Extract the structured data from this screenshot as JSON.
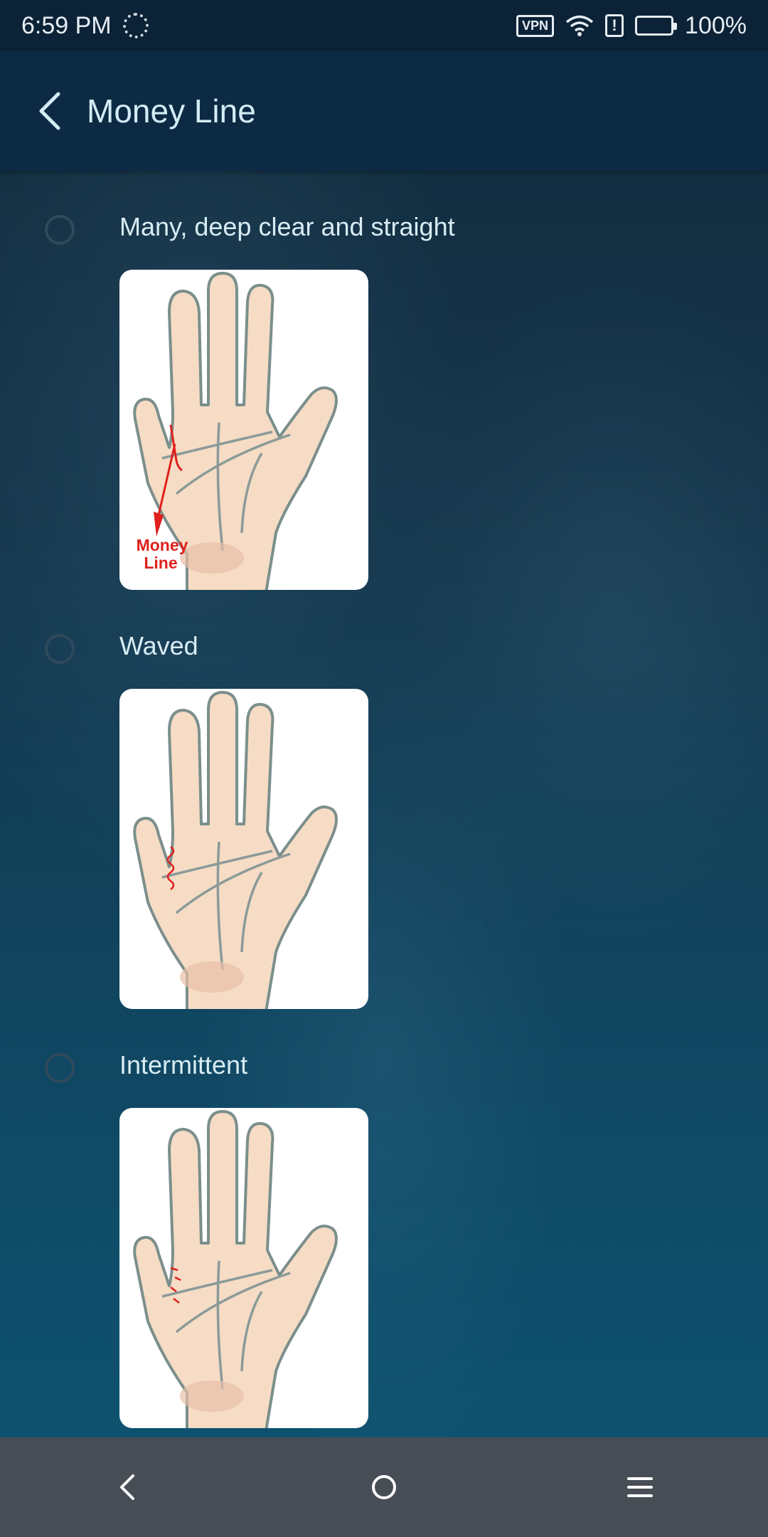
{
  "status_bar": {
    "time": "6:59 PM",
    "vpn_label": "VPN",
    "battery": "100%",
    "icons": [
      "spinner-icon",
      "vpn-icon",
      "wifi-icon",
      "alert-icon",
      "battery-icon"
    ]
  },
  "app_bar": {
    "title": "Money Line",
    "back_icon": "chevron-left-icon"
  },
  "options": [
    {
      "label": "Many, deep clear and straight",
      "image_caption": "Money Line"
    },
    {
      "label": "Waved"
    },
    {
      "label": "Intermittent"
    }
  ],
  "nav_bar": {
    "icons": [
      "nav-back-icon",
      "home-icon",
      "menu-icon"
    ]
  },
  "colors": {
    "app_bar": "#0d2a44",
    "title_text": "#d4ecf5",
    "nav_bar": "#474e55",
    "accent_red": "#e0201c"
  }
}
